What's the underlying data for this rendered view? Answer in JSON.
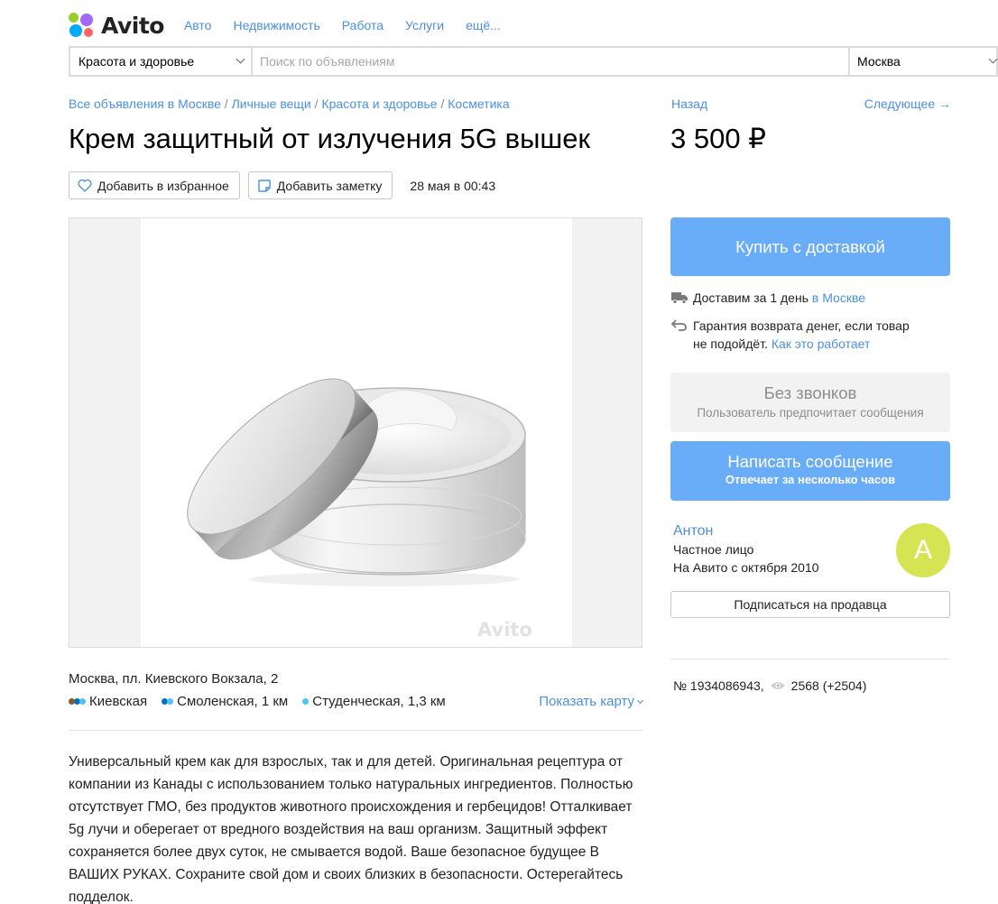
{
  "header": {
    "logo_text": "Avito",
    "nav": [
      "Авто",
      "Недвижимость",
      "Работа",
      "Услуги",
      "ещё..."
    ]
  },
  "search": {
    "category": "Красота и здоровье",
    "placeholder": "Поиск по объявлениям",
    "value": "",
    "city": "Москва"
  },
  "breadcrumb": {
    "items": [
      "Все объявления в Москве",
      "Личные вещи",
      "Красота и здоровье",
      "Косметика"
    ],
    "separator": "/"
  },
  "navigation": {
    "back": "Назад",
    "next": "Следующее →"
  },
  "listing": {
    "title": "Крем защитный от излучения 5G вышек",
    "price": "3 500 ₽",
    "favorite_label": "Добавить в избранное",
    "note_label": "Добавить заметку",
    "date": "28 мая в 00:43",
    "watermark": "Avito",
    "address": "Москва, пл. Киевского Вокзала, 2",
    "metro": [
      {
        "name": "Киевская",
        "colors": [
          "#8b5a2b",
          "#0072ba",
          "#4fc3f7"
        ]
      },
      {
        "name": "Смоленская, 1 км",
        "colors": [
          "#0072ba",
          "#4fc3f7"
        ]
      },
      {
        "name": "Студенческая, 1,3 км",
        "colors": [
          "#4fc3f7"
        ]
      }
    ],
    "show_map": "Показать карту",
    "description": "Универсальный крем как для взрослых, так и для детей. Оригинальная рецептура от компании из Канады с использованием только натуральных ингредиентов. Полностью отсутствует ГМО, без продуктов животного происхождения и гербецидов! Отталкивает 5g лучи и оберегает от вредного воздействия на ваш организм. Защитный эффект сохраняется более двух суток, не смывается водой. Ваше безопасное будущее В ВАШИХ РУКАХ. Сохраните свой дом и своих близких в безопасности. Остерегайтесь подделок."
  },
  "sidebar": {
    "buy_label": "Купить с доставкой",
    "delivery_text": "Доставим за 1 день",
    "delivery_link": "в Москве",
    "guarantee_text_1": "Гарантия возврата денег, если товар",
    "guarantee_text_2": "не подойдёт.",
    "guarantee_link": "Как это работает",
    "no_calls_title": "Без звонков",
    "no_calls_sub": "Пользователь предпочитает сообщения",
    "message_title": "Написать сообщение",
    "message_sub": "Отвечает за несколько часов",
    "seller_name": "Антон",
    "seller_type": "Частное лицо",
    "seller_since": "На Авито с октября 2010",
    "avatar_letter": "А",
    "subscribe_label": "Подписаться на продавца",
    "item_number": "№ 1934086943,",
    "views": "2568 (+2504)"
  },
  "colors": {
    "accent": "#69acf8",
    "link": "#4a90e2",
    "avatar": "#d5e452"
  }
}
